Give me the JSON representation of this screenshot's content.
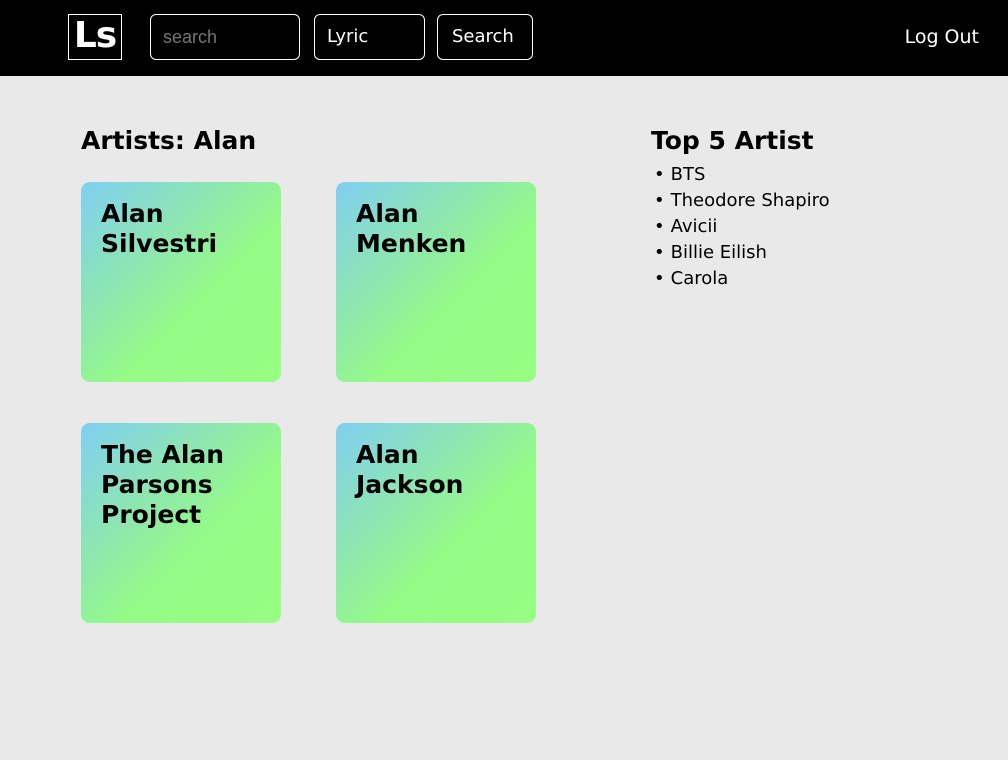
{
  "header": {
    "logo_text": "Ls",
    "search_placeholder": "search",
    "search_type": "Lyric",
    "search_button": "Search",
    "logout_label": "Log Out"
  },
  "results": {
    "title": "Artists: Alan",
    "artists": [
      {
        "name": "Alan Silvestri"
      },
      {
        "name": "Alan Menken"
      },
      {
        "name": "The Alan Parsons Project"
      },
      {
        "name": "Alan Jackson"
      }
    ]
  },
  "top5": {
    "title": "Top 5 Artist",
    "bullet": "•",
    "items": [
      "BTS",
      "Theodore Shapiro",
      "Avicii",
      "Billie Eilish",
      "Carola"
    ]
  },
  "colors": {
    "header_bg": "#000000",
    "page_bg": "#e9e9e9",
    "card_gradient_start": "#7fcff2",
    "card_gradient_end": "#96fe82"
  }
}
